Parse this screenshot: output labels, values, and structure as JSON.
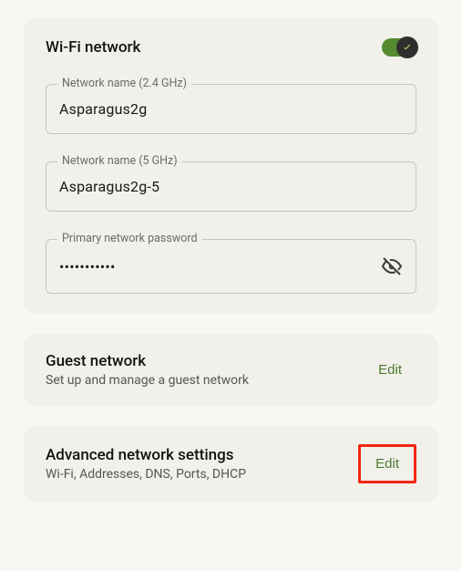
{
  "wifi": {
    "title": "Wi-Fi network",
    "enabled": true,
    "fields": {
      "name24": {
        "label": "Network name (2.4 GHz)",
        "value": "Asparagus2g"
      },
      "name5": {
        "label": "Network name (5 GHz)",
        "value": "Asparagus2g-5"
      },
      "password": {
        "label": "Primary network password",
        "masked": "•••••••••••"
      }
    }
  },
  "guest": {
    "title": "Guest network",
    "subtitle": "Set up and manage a guest network",
    "action": "Edit"
  },
  "advanced": {
    "title": "Advanced network settings",
    "subtitle": "Wi-Fi, Addresses, DNS, Ports, DHCP",
    "action": "Edit"
  },
  "colors": {
    "accent": "#4a7a2c",
    "toggle": "#558b2f",
    "highlight": "#f22613"
  }
}
